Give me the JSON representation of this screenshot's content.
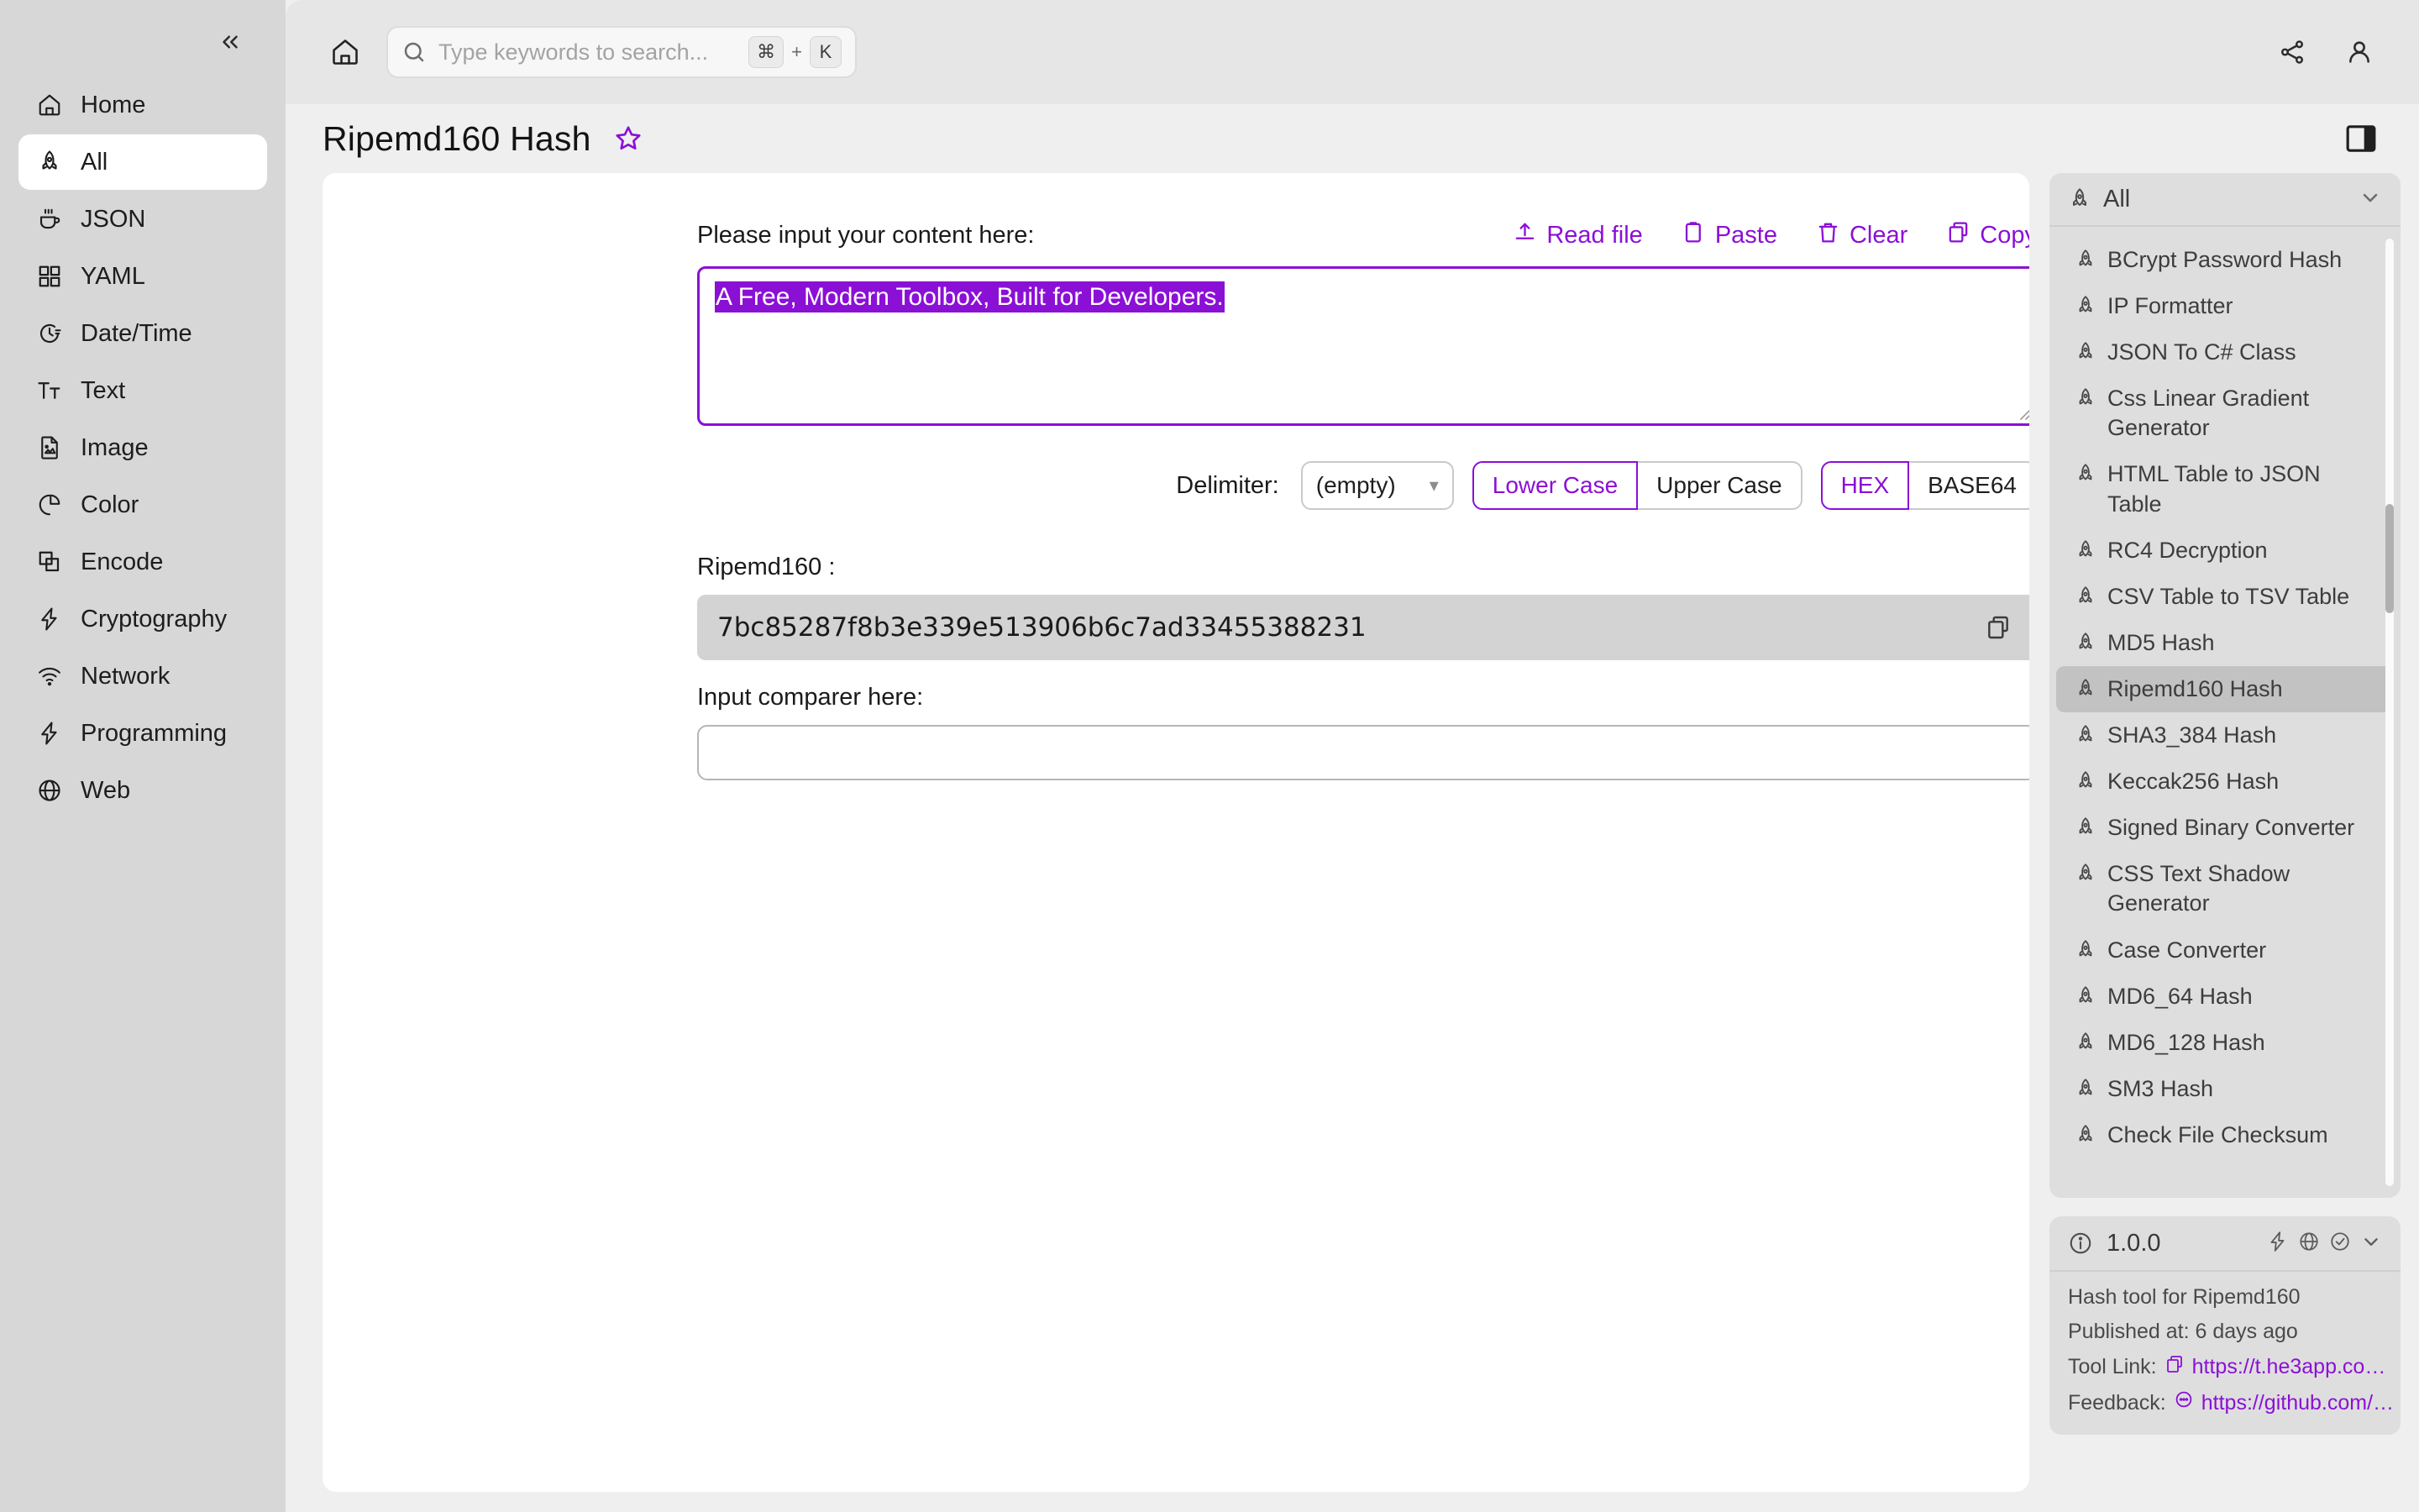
{
  "sidebar": {
    "collapse_icon": "chevrons-left-icon",
    "items": [
      {
        "label": "Home",
        "icon": "home-icon",
        "active": false
      },
      {
        "label": "All",
        "icon": "rocket-icon",
        "active": true
      },
      {
        "label": "JSON",
        "icon": "coffee-icon",
        "active": false
      },
      {
        "label": "YAML",
        "icon": "grid-icon",
        "active": false
      },
      {
        "label": "Date/Time",
        "icon": "clock-icon",
        "active": false
      },
      {
        "label": "Text",
        "icon": "text-size-icon",
        "active": false
      },
      {
        "label": "Image",
        "icon": "image-file-icon",
        "active": false
      },
      {
        "label": "Color",
        "icon": "pie-chart-icon",
        "active": false
      },
      {
        "label": "Encode",
        "icon": "layers-icon",
        "active": false
      },
      {
        "label": "Cryptography",
        "icon": "lightning-icon",
        "active": false
      },
      {
        "label": "Network",
        "icon": "wifi-icon",
        "active": false
      },
      {
        "label": "Programming",
        "icon": "lightning-icon",
        "active": false
      },
      {
        "label": "Web",
        "icon": "globe-icon",
        "active": false
      }
    ]
  },
  "topbar": {
    "home_icon": "home-icon",
    "search": {
      "placeholder": "Type keywords to search...",
      "value": "",
      "icon": "search-icon",
      "shortcut_key": "⌘",
      "shortcut_plus": "+",
      "shortcut_letter": "K"
    },
    "share_icon": "share-icon",
    "account_icon": "user-icon"
  },
  "page": {
    "title": "Ripemd160 Hash",
    "favorite_icon": "star-icon",
    "panel_toggle_icon": "sidebar-toggle-icon"
  },
  "tool": {
    "input_label": "Please input your content here:",
    "actions": [
      {
        "label": "Read file",
        "icon": "upload-icon"
      },
      {
        "label": "Paste",
        "icon": "clipboard-icon"
      },
      {
        "label": "Clear",
        "icon": "trash-icon"
      },
      {
        "label": "Copy",
        "icon": "copy-icon"
      }
    ],
    "input_value": "A Free, Modern Toolbox, Built for Developers.",
    "input_selected": true,
    "delimiter_label": "Delimiter:",
    "delimiter_value": "(empty)",
    "case_options": [
      {
        "label": "Lower Case",
        "active": true
      },
      {
        "label": "Upper Case",
        "active": false
      }
    ],
    "encoding_options": [
      {
        "label": "HEX",
        "active": true
      },
      {
        "label": "BASE64",
        "active": false
      }
    ],
    "result_label": "Ripemd160 :",
    "result_value": "7bc85287f8b3e339e513906b6c7ad33455388231",
    "result_copy_icon": "copy-icon",
    "comparer_label": "Input comparer here:",
    "comparer_value": "",
    "comparer_placeholder": ""
  },
  "tool_panel": {
    "header_label": "All",
    "header_icon": "rocket-icon",
    "header_chevron": "chevron-down-icon",
    "items": [
      {
        "label": "BCrypt Password Hash",
        "active": false
      },
      {
        "label": "IP Formatter",
        "active": false
      },
      {
        "label": "JSON To C# Class",
        "active": false
      },
      {
        "label": "Css Linear Gradient Generator",
        "active": false
      },
      {
        "label": "HTML Table to JSON Table",
        "active": false
      },
      {
        "label": "RC4 Decryption",
        "active": false
      },
      {
        "label": "CSV Table to TSV Table",
        "active": false
      },
      {
        "label": "MD5 Hash",
        "active": false
      },
      {
        "label": "Ripemd160 Hash",
        "active": true
      },
      {
        "label": "SHA3_384 Hash",
        "active": false
      },
      {
        "label": "Keccak256 Hash",
        "active": false
      },
      {
        "label": "Signed Binary Converter",
        "active": false
      },
      {
        "label": "CSS Text Shadow Generator",
        "active": false
      },
      {
        "label": "Case Converter",
        "active": false
      },
      {
        "label": "MD6_64 Hash",
        "active": false
      },
      {
        "label": "MD6_128 Hash",
        "active": false
      },
      {
        "label": "SM3 Hash",
        "active": false
      },
      {
        "label": "Check File Checksum",
        "active": false
      }
    ]
  },
  "info_panel": {
    "info_icon": "info-circle-icon",
    "version": "1.0.0",
    "head_icons": [
      "lightning-icon",
      "globe-icon",
      "check-circle-icon",
      "chevron-down-icon"
    ],
    "description": "Hash tool for Ripemd160",
    "published": "Published at: 6 days ago",
    "tool_link_label": "Tool Link:",
    "tool_link_value": "https://t.he3app.co…",
    "tool_link_icon": "copy-icon",
    "feedback_label": "Feedback:",
    "feedback_value": "https://github.com/…",
    "feedback_icon": "message-icon"
  },
  "colors": {
    "accent": "#8b10d6",
    "sidebar_bg": "#d7d7d7",
    "page_bg": "#efefef",
    "card_bg": "#ffffff",
    "panel_bg": "#dedede"
  }
}
